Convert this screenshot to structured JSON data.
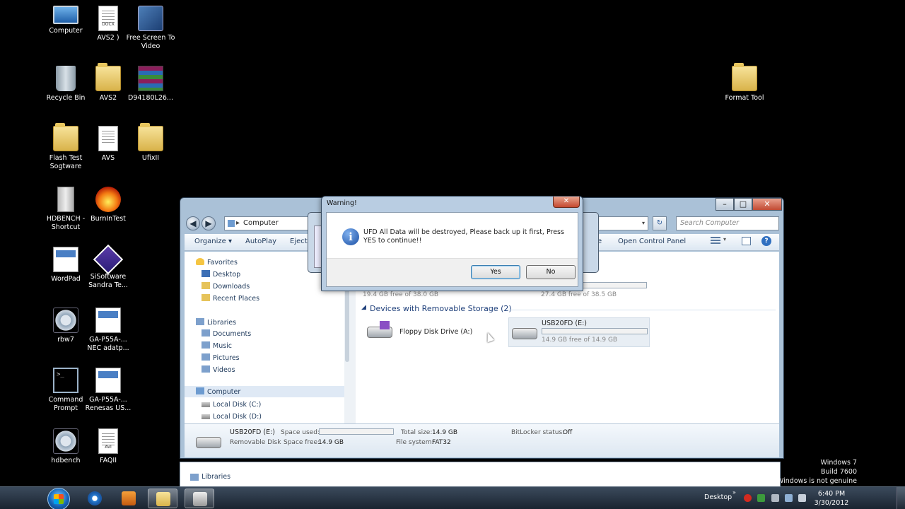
{
  "desktop": {
    "icons": [
      {
        "label": "Computer",
        "glyph": "g-monitor"
      },
      {
        "label": "AVS2 )",
        "glyph": "g-doc",
        "badge": "DOCX"
      },
      {
        "label": "Free Screen To Video",
        "glyph": "g-app"
      },
      {
        "label": "Recycle Bin",
        "glyph": "g-bin"
      },
      {
        "label": "AVS2",
        "glyph": "g-folder"
      },
      {
        "label": "D94180L26...",
        "glyph": "g-rar"
      },
      {
        "label": "Flash Test Sogtware",
        "glyph": "g-folder"
      },
      {
        "label": "AVS",
        "glyph": "g-doc"
      },
      {
        "label": "UfixII",
        "glyph": "g-folder"
      },
      {
        "label": "HDBENCH - Shortcut",
        "glyph": "g-tower"
      },
      {
        "label": "BurnInTest",
        "glyph": "g-fire"
      },
      {
        "label": "WordPad",
        "glyph": "g-doc2"
      },
      {
        "label": "SiSoftware Sandra Te...",
        "glyph": "g-diamond"
      },
      {
        "label": "rbw7",
        "glyph": "g-gear"
      },
      {
        "label": "GA-P55A-... NEC adatp...",
        "glyph": "g-doc2"
      },
      {
        "label": "Command Prompt",
        "glyph": "g-cmd"
      },
      {
        "label": "GA-P55A-... Renesas US...",
        "glyph": "g-doc2"
      },
      {
        "label": "hdbench",
        "glyph": "g-gear"
      },
      {
        "label": "FAQII",
        "glyph": "g-doc",
        "badge": "AVI"
      },
      {
        "label": "Format Tool",
        "glyph": "g-folder"
      }
    ],
    "watermark": [
      "Windows 7",
      "Build 7600",
      "f Windows is not genuine"
    ]
  },
  "explorer": {
    "address": "Computer",
    "search_placeholder": "Search Computer",
    "toolbar": {
      "organize": "Organize ▾",
      "autoplay": "AutoPlay",
      "eject": "Eject",
      "open_control_panel": "Open Control Panel",
      "partial": "e"
    },
    "nav": {
      "favorites": "Favorites",
      "desktop": "Desktop",
      "downloads": "Downloads",
      "recent": "Recent Places",
      "libraries": "Libraries",
      "documents": "Documents",
      "music": "Music",
      "pictures": "Pictures",
      "videos": "Videos",
      "computer": "Computer",
      "local_c": "Local Disk (C:)",
      "local_d": "Local Disk (D:)"
    },
    "hdd_free_c": "19.4 GB free of 38.0 GB",
    "hdd_free_d": "27.4 GB free of 38.5 GB",
    "removable_header": "Devices with Removable Storage (2)",
    "floppy": "Floppy Disk Drive (A:)",
    "usb": {
      "name": "USB20FD (E:)",
      "free": "14.9 GB free of 14.9 GB",
      "used_fraction": 0.0
    },
    "details": {
      "name": "USB20FD (E:)",
      "type": "Removable Disk",
      "space_used_label": "Space used:",
      "space_free_label": "Space free:",
      "space_free": "14.9 GB",
      "total_label": "Total size:",
      "total": "14.9 GB",
      "fs_label": "File system:",
      "fs": "FAT32",
      "bitlocker_label": "BitLocker status:",
      "bitlocker": "Off"
    },
    "lower_panel_item": "Libraries"
  },
  "warning": {
    "title": "Warning!",
    "message": "UFD All Data will be destroyed, Please back up it first, Press YES to continue!!",
    "yes": "Yes",
    "no": "No"
  },
  "taskbar": {
    "desktop_label": "Desktop",
    "time": "6:40 PM",
    "date": "3/30/2012"
  },
  "colors": {
    "accent": "#1e395b",
    "warning_icon": "#1b4fa4"
  }
}
